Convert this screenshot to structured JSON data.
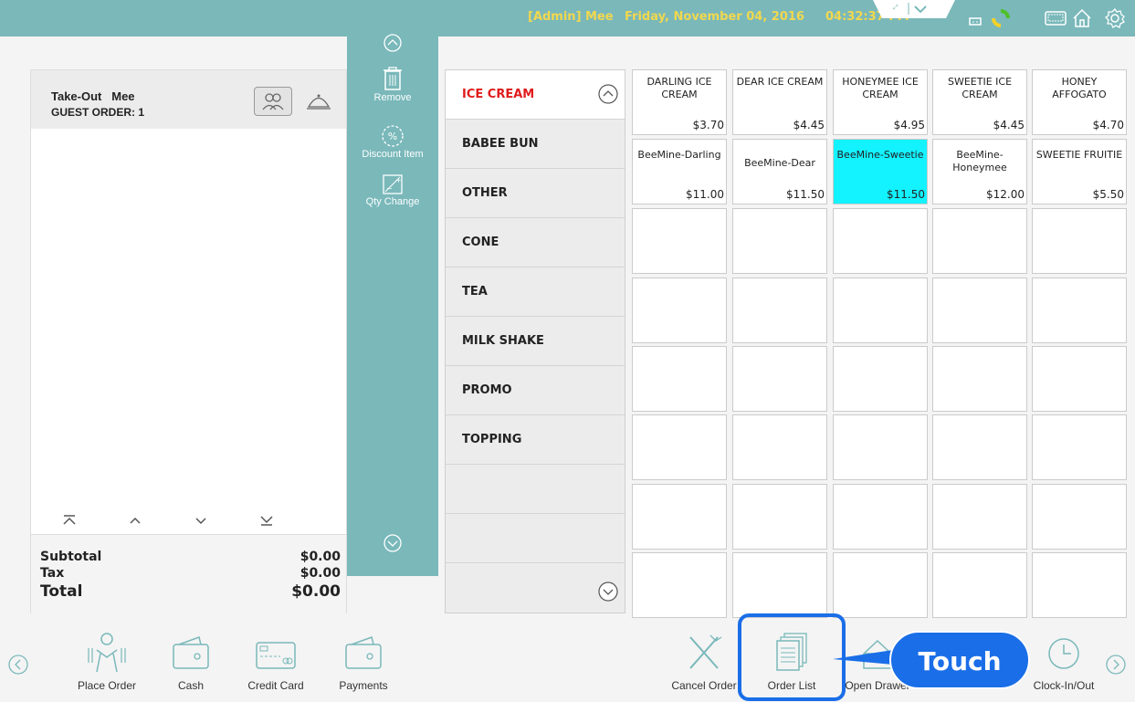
{
  "header": {
    "user": "[Admin] Mee",
    "date": "Friday, November 04, 2016",
    "time": "04:32:37 PM",
    "icons": [
      "expand-icon",
      "chevron-down-icon",
      "plug-icon",
      "sync-icon",
      "keyboard-icon",
      "home-icon",
      "gear-icon"
    ]
  },
  "order": {
    "type": "Take-Out",
    "customer": "Mee",
    "guest_label": "GUEST ORDER:",
    "guest_number": "1",
    "subtotal_label": "Subtotal",
    "subtotal_value": "$0.00",
    "tax_label": "Tax",
    "tax_value": "$0.00",
    "total_label": "Total",
    "total_value": "$0.00"
  },
  "actions": [
    {
      "label": "Remove",
      "icon": "trash-icon"
    },
    {
      "label": "Discount Item",
      "icon": "percent-icon"
    },
    {
      "label": "Qty Change",
      "icon": "qty-change-icon"
    }
  ],
  "categories": [
    {
      "label": "ICE CREAM",
      "active": true
    },
    {
      "label": "BABEE BUN"
    },
    {
      "label": "OTHER"
    },
    {
      "label": "CONE"
    },
    {
      "label": "TEA"
    },
    {
      "label": "MILK SHAKE"
    },
    {
      "label": "PROMO"
    },
    {
      "label": "TOPPING"
    },
    {
      "label": ""
    },
    {
      "label": ""
    },
    {
      "label": ""
    }
  ],
  "items": [
    {
      "name": "DARLING ICE CREAM",
      "price": "$3.70"
    },
    {
      "name": "DEAR ICE CREAM",
      "price": "$4.45"
    },
    {
      "name": "HONEYMEE ICE CREAM",
      "price": "$4.95"
    },
    {
      "name": "SWEETIE ICE CREAM",
      "price": "$4.45"
    },
    {
      "name": "HONEY AFFOGATO",
      "price": "$4.70"
    },
    {
      "name": "BeeMine-Darling",
      "price": "$11.00"
    },
    {
      "name": "BeeMine-Dear",
      "price": "$11.50"
    },
    {
      "name": "BeeMine-Sweetie",
      "price": "$11.50",
      "highlighted": true
    },
    {
      "name": "BeeMine-Honeymee",
      "price": "$12.00"
    },
    {
      "name": "SWEETIE FRUITIE",
      "price": "$5.50"
    }
  ],
  "toolbar": {
    "left": [
      {
        "label": "Place Order",
        "icon": "waiter-icon"
      },
      {
        "label": "Cash",
        "icon": "wallet-icon"
      },
      {
        "label": "Credit Card",
        "icon": "credit-card-icon"
      },
      {
        "label": "Payments",
        "icon": "wallet-icon"
      }
    ],
    "right": [
      {
        "label": "Cancel Order",
        "icon": "cancel-order-icon"
      },
      {
        "label": "Order List",
        "icon": "order-list-icon"
      },
      {
        "label": "Open Drawer",
        "icon": "drawer-icon"
      },
      {
        "label": "Clock-In/Out",
        "icon": "clock-icon"
      }
    ]
  },
  "callout": {
    "label": "Touch",
    "color": "#1a6ee8"
  },
  "colors": {
    "teal": "#7ab8ba",
    "header_text": "#f1d84f",
    "active_category": "#e01b1b",
    "highlight_item": "#12f2ff"
  }
}
